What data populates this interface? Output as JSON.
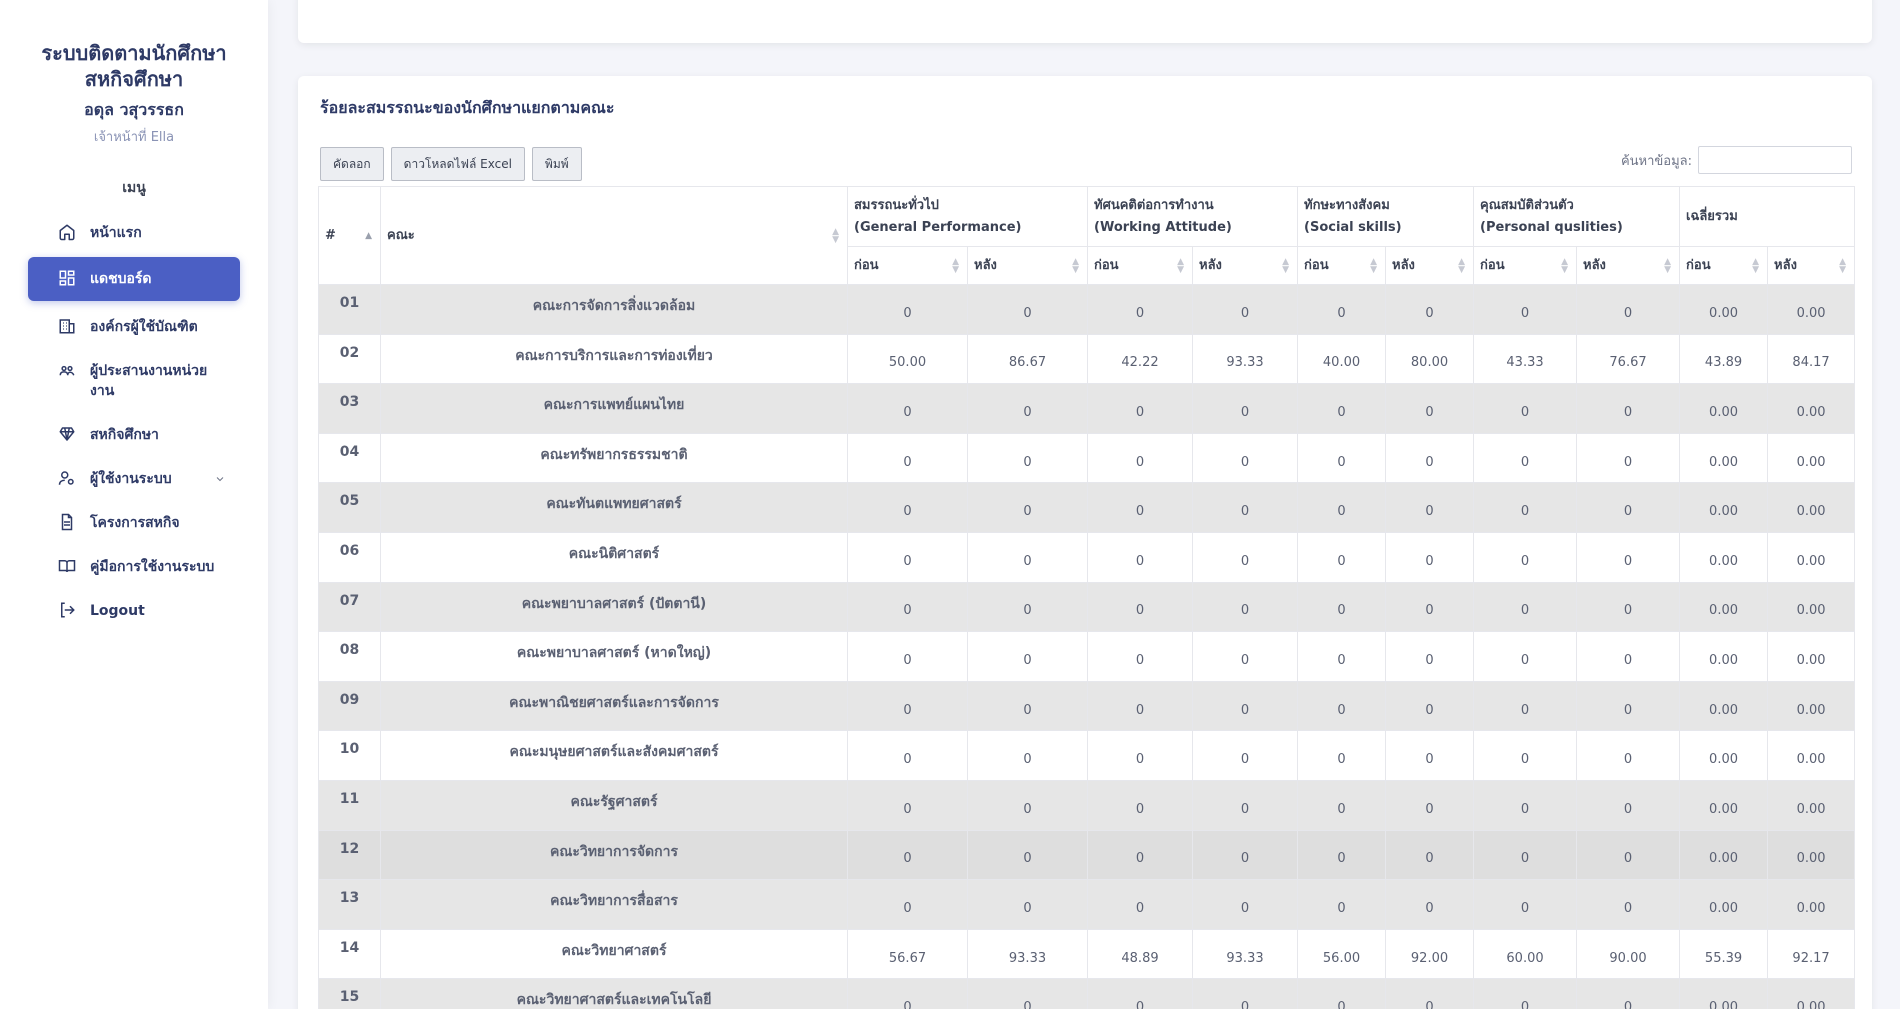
{
  "sidebar": {
    "title_line1": "ระบบติดตามนักศึกษา",
    "title_line2": "สหกิจศึกษา",
    "user_name": "อดุล วสุวรรธก",
    "user_role": "เจ้าหน้าที่ Ella",
    "menu_heading": "เมนู",
    "items": [
      {
        "label": "หน้าแรก",
        "icon": "home-icon"
      },
      {
        "label": "แดชบอร์ด",
        "icon": "dashboard-icon",
        "active": true
      },
      {
        "label": "องค์กรผู้ใช้บัณฑิต",
        "icon": "building-icon"
      },
      {
        "label": "ผู้ประสานงานหน่วยงาน",
        "icon": "users-icon"
      },
      {
        "label": "สหกิจศึกษา",
        "icon": "diamond-icon"
      },
      {
        "label": "ผู้ใช้งานระบบ",
        "icon": "user-settings-icon"
      },
      {
        "label": "โครงการสหกิจ",
        "icon": "document-icon"
      },
      {
        "label": "คู่มือการใช้งานระบบ",
        "icon": "book-icon"
      },
      {
        "label": "Logout",
        "icon": "logout-icon"
      }
    ]
  },
  "card": {
    "title": "ร้อยละสมรรถนะของนักศึกษาแยกตามคณะ",
    "buttons": {
      "copy": "คัดลอก",
      "excel": "ดาวโหลดไฟล์ Excel",
      "print": "พิมพ์"
    },
    "search_label": "ค้นหาข้อมูล:",
    "search_value": ""
  },
  "table": {
    "col_index": "#",
    "col_faculty": "คณะ",
    "groups": [
      {
        "line1": "สมรรถนะทั่วไป",
        "line2": "(General Performance)"
      },
      {
        "line1": "ทัศนคติต่อการทำงาน",
        "line2": "(Working Attitude)"
      },
      {
        "line1": "ทักษะทางสังคม",
        "line2": "(Social skills)"
      },
      {
        "line1": "คุณสมบัติส่วนตัว",
        "line2": "(Personal quslities)"
      },
      {
        "line1": "เฉลี่ยรวม",
        "line2": ""
      }
    ],
    "before_label": "ก่อน",
    "after_label": "หลัง",
    "rows": [
      {
        "no": "01",
        "faculty": "คณะการจัดการสิ่งแวดล้อม",
        "v": [
          "0",
          "0",
          "0",
          "0",
          "0",
          "0",
          "0",
          "0",
          "0.00",
          "0.00"
        ]
      },
      {
        "no": "02",
        "faculty": "คณะการบริการและการท่องเที่ยว",
        "v": [
          "50.00",
          "86.67",
          "42.22",
          "93.33",
          "40.00",
          "80.00",
          "43.33",
          "76.67",
          "43.89",
          "84.17"
        ]
      },
      {
        "no": "03",
        "faculty": "คณะการแพทย์แผนไทย",
        "v": [
          "0",
          "0",
          "0",
          "0",
          "0",
          "0",
          "0",
          "0",
          "0.00",
          "0.00"
        ]
      },
      {
        "no": "04",
        "faculty": "คณะทรัพยากรธรรมชาติ",
        "v": [
          "0",
          "0",
          "0",
          "0",
          "0",
          "0",
          "0",
          "0",
          "0.00",
          "0.00"
        ]
      },
      {
        "no": "05",
        "faculty": "คณะทันตแพทยศาสตร์",
        "v": [
          "0",
          "0",
          "0",
          "0",
          "0",
          "0",
          "0",
          "0",
          "0.00",
          "0.00"
        ]
      },
      {
        "no": "06",
        "faculty": "คณะนิติศาสตร์",
        "v": [
          "0",
          "0",
          "0",
          "0",
          "0",
          "0",
          "0",
          "0",
          "0.00",
          "0.00"
        ]
      },
      {
        "no": "07",
        "faculty": "คณะพยาบาลศาสตร์ (ปัตตานี)",
        "v": [
          "0",
          "0",
          "0",
          "0",
          "0",
          "0",
          "0",
          "0",
          "0.00",
          "0.00"
        ]
      },
      {
        "no": "08",
        "faculty": "คณะพยาบาลศาสตร์ (หาดใหญ่)",
        "v": [
          "0",
          "0",
          "0",
          "0",
          "0",
          "0",
          "0",
          "0",
          "0.00",
          "0.00"
        ]
      },
      {
        "no": "09",
        "faculty": "คณะพาณิชยศาสตร์และการจัดการ",
        "v": [
          "0",
          "0",
          "0",
          "0",
          "0",
          "0",
          "0",
          "0",
          "0.00",
          "0.00"
        ]
      },
      {
        "no": "10",
        "faculty": "คณะมนุษยศาสตร์และสังคมศาสตร์",
        "v": [
          "0",
          "0",
          "0",
          "0",
          "0",
          "0",
          "0",
          "0",
          "0.00",
          "0.00"
        ]
      },
      {
        "no": "11",
        "faculty": "คณะรัฐศาสตร์",
        "v": [
          "0",
          "0",
          "0",
          "0",
          "0",
          "0",
          "0",
          "0",
          "0.00",
          "0.00"
        ]
      },
      {
        "no": "12",
        "faculty": "คณะวิทยาการจัดการ",
        "v": [
          "0",
          "0",
          "0",
          "0",
          "0",
          "0",
          "0",
          "0",
          "0.00",
          "0.00"
        ]
      },
      {
        "no": "13",
        "faculty": "คณะวิทยาการสื่อสาร",
        "v": [
          "0",
          "0",
          "0",
          "0",
          "0",
          "0",
          "0",
          "0",
          "0.00",
          "0.00"
        ]
      },
      {
        "no": "14",
        "faculty": "คณะวิทยาศาสตร์",
        "v": [
          "56.67",
          "93.33",
          "48.89",
          "93.33",
          "56.00",
          "92.00",
          "60.00",
          "90.00",
          "55.39",
          "92.17"
        ]
      },
      {
        "no": "15",
        "faculty": "คณะวิทยาศาสตร์และเทคโนโลยี",
        "v": [
          "0",
          "0",
          "0",
          "0",
          "0",
          "0",
          "0",
          "0",
          "0.00",
          "0.00"
        ]
      }
    ]
  }
}
